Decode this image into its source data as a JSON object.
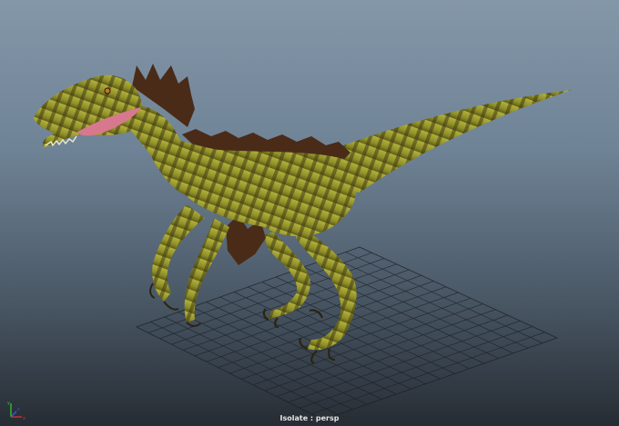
{
  "viewport": {
    "camera_label": "Isolate : persp",
    "background_top": "#8497a9",
    "background_bottom": "#262c33"
  },
  "model": {
    "name_icon": "raptor-model",
    "skin_color": "#9ea032",
    "stripe_color": "#3f3a14",
    "feather_color": "#4a2b18",
    "mouth_color": "#d8788e"
  },
  "axis_gizmo": {
    "x_label": "x",
    "y_label": "y",
    "z_label": "z",
    "x_color": "#d23030",
    "y_color": "#30c030",
    "z_color": "#3a5ad8"
  }
}
